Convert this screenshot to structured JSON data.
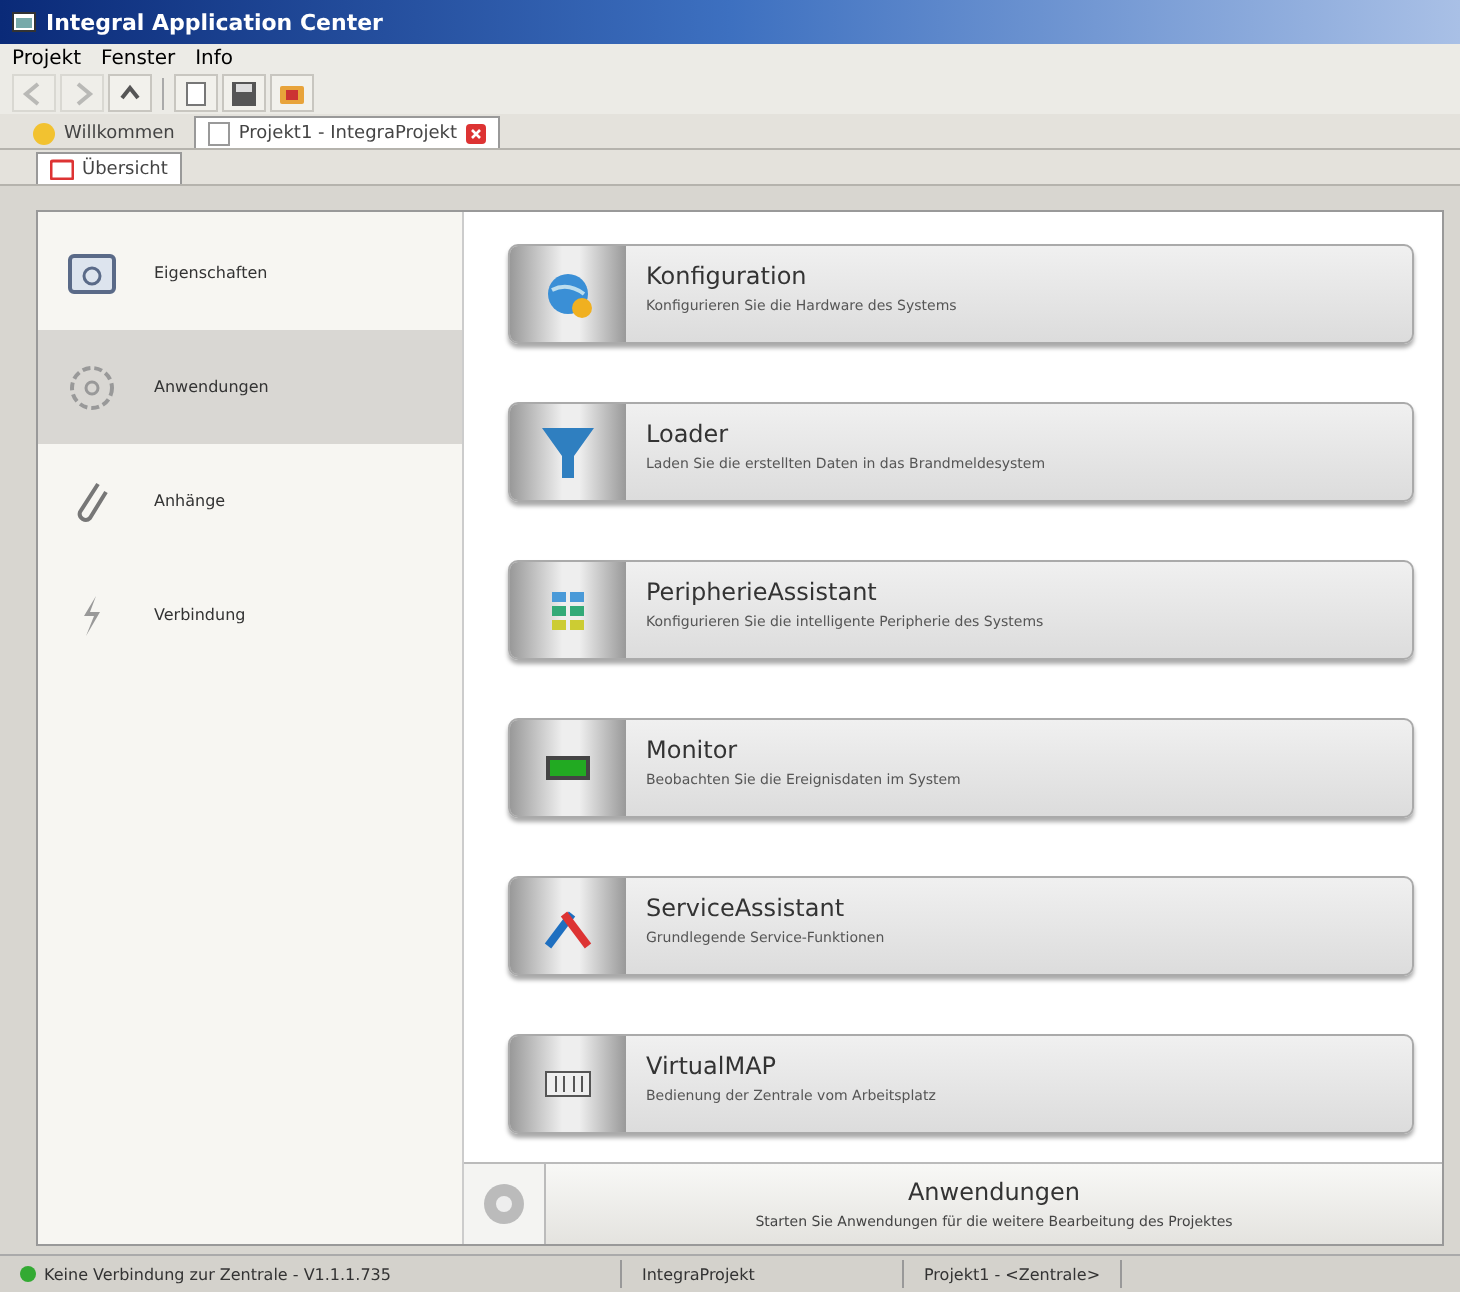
{
  "window": {
    "title": "Integral Application Center"
  },
  "menu": [
    "Projekt",
    "Fenster",
    "Info"
  ],
  "toolbar": [
    {
      "kind": "back",
      "disabled": true
    },
    {
      "kind": "forward",
      "disabled": true
    },
    {
      "kind": "up",
      "disabled": false
    },
    {
      "kind": "new",
      "disabled": false
    },
    {
      "kind": "save",
      "disabled": false
    },
    {
      "kind": "open",
      "disabled": false
    }
  ],
  "tabs": [
    {
      "label": "Willkommen",
      "selected": false,
      "closable": false
    },
    {
      "label": "Projekt1 - IntegraProjekt",
      "selected": true,
      "closable": true
    }
  ],
  "subtabs": [
    {
      "label": "Übersicht",
      "selected": true
    }
  ],
  "sidebar": {
    "items": [
      {
        "label": "Eigenschaften",
        "kind": "properties",
        "selected": false
      },
      {
        "label": "Anwendungen",
        "kind": "applications",
        "selected": true
      },
      {
        "label": "Anhänge",
        "kind": "attachments",
        "selected": false
      },
      {
        "label": "Verbindung",
        "kind": "connection",
        "selected": false
      }
    ]
  },
  "applications": [
    {
      "kind": "config",
      "title": "Konfiguration",
      "description": "Konfigurieren Sie die Hardware des Systems"
    },
    {
      "kind": "loader",
      "title": "Loader",
      "description": "Laden Sie die erstellten Daten in das Brandmeldesystem"
    },
    {
      "kind": "periphery",
      "title": "PeripherieAssistant",
      "description": "Konfigurieren Sie die intelligente Peripherie des Systems"
    },
    {
      "kind": "monitor",
      "title": "Monitor",
      "description": "Beobachten Sie die Ereignisdaten im System"
    },
    {
      "kind": "service",
      "title": "ServiceAssistant",
      "description": "Grundlegende Service-Funktionen"
    },
    {
      "kind": "virtual",
      "title": "VirtualMAP",
      "description": "Bedienung der Zentrale vom Arbeitsplatz"
    }
  ],
  "info_panel": {
    "title": "Anwendungen",
    "description": "Starten Sie Anwendungen für die weitere Bearbeitung des Projektes"
  },
  "status_bar": [
    "Keine Verbindung zur Zentrale - V1.1.1.735",
    "IntegraProjekt",
    "Projekt1 - <Zentrale>"
  ]
}
